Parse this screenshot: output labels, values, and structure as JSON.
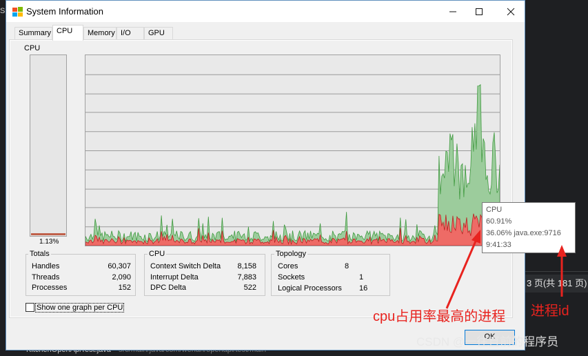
{
  "window": {
    "title": "System Information"
  },
  "tabs": [
    {
      "label": "Summary"
    },
    {
      "label": "CPU"
    },
    {
      "label": "Memory"
    },
    {
      "label": "I/O"
    },
    {
      "label": "GPU"
    }
  ],
  "meter": {
    "label": "CPU",
    "percent_text": "1.13%",
    "percent": 1.13
  },
  "totals": {
    "title": "Totals",
    "rows": [
      {
        "label": "Handles",
        "value": "60,307"
      },
      {
        "label": "Threads",
        "value": "2,090"
      },
      {
        "label": "Processes",
        "value": "152"
      }
    ]
  },
  "cpu_group": {
    "title": "CPU",
    "rows": [
      {
        "label": "Context Switch Delta",
        "value": "8,158"
      },
      {
        "label": "Interrupt Delta",
        "value": "7,883"
      },
      {
        "label": "DPC Delta",
        "value": "522"
      }
    ]
  },
  "topology": {
    "title": "Topology",
    "rows": [
      {
        "label": "Cores",
        "value": "8"
      },
      {
        "label": "Sockets",
        "value": "1"
      },
      {
        "label": "Logical Processors",
        "value": "16"
      }
    ]
  },
  "options": {
    "show_per_cpu_label": "Show one graph per CPU"
  },
  "buttons": {
    "ok_label": "OK"
  },
  "tooltip": {
    "title": "CPU",
    "total": "60.91%",
    "process": "36.06% java.exe:9716",
    "time": "9:41:33"
  },
  "annotations": {
    "highest_process": "cpu占用率最高的进程",
    "process_id": "进程id"
  },
  "background": {
    "pager_text": "3 页(共 181 页)",
    "bottom_file": "KitchenOpenApiTest.java",
    "bottom_path": "src/main/java/com/wenan/openapi/test/main",
    "watermark": "CSDN @一往直前的程序员"
  },
  "colors": {
    "total_area": "#8fc48f",
    "kernel_area": "#e8605a",
    "annotation": "#e8231f"
  }
}
